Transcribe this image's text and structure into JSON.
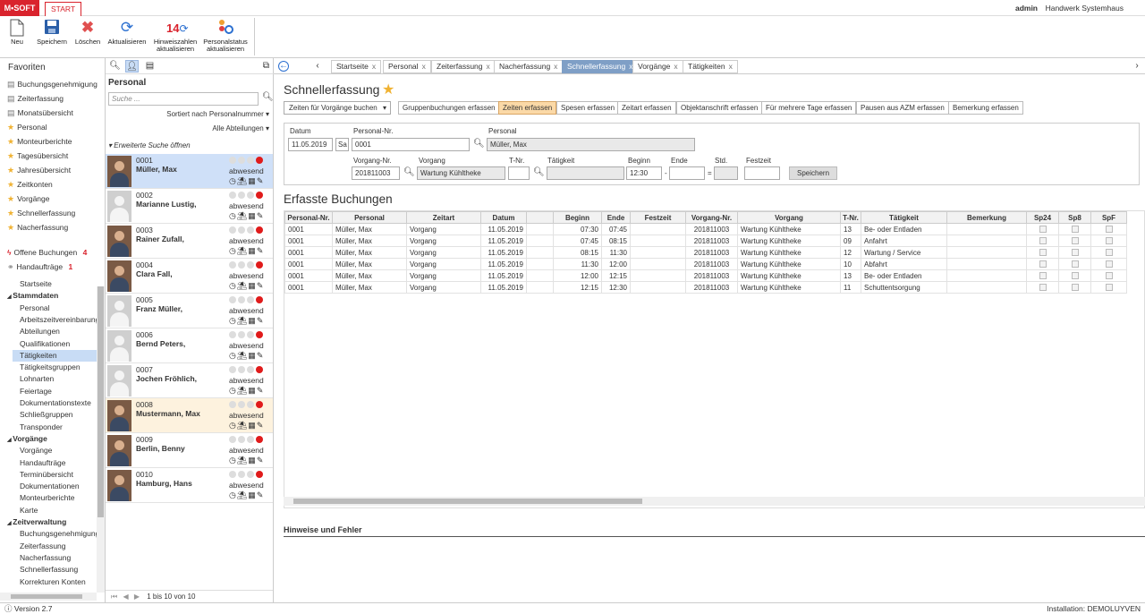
{
  "app": {
    "brand": "M•SOFT",
    "tab": "START",
    "user": "admin",
    "company": "Handwerk Systemhaus"
  },
  "ribbon": [
    {
      "id": "new",
      "label": "Neu",
      "icon": "document-icon"
    },
    {
      "id": "save",
      "label": "Speichern",
      "icon": "save-icon"
    },
    {
      "id": "delete",
      "label": "Löschen",
      "icon": "delete-icon"
    },
    {
      "id": "refresh",
      "label": "Aktualisieren",
      "icon": "refresh-icon"
    },
    {
      "id": "hints",
      "label": "Hinweiszahlen aktualisieren",
      "icon": "hint-refresh-icon",
      "badge": "14"
    },
    {
      "id": "pstatus",
      "label": "Personalstatus aktualisieren",
      "icon": "status-refresh-icon"
    }
  ],
  "favorites": {
    "title": "Favoriten",
    "items": [
      {
        "label": "Buchungsgenehmigung",
        "icon": "doc"
      },
      {
        "label": "Zeiterfassung",
        "icon": "doc"
      },
      {
        "label": "Monatsübersicht",
        "icon": "doc"
      },
      {
        "label": "Personal",
        "icon": "star"
      },
      {
        "label": "Monteurberichte",
        "icon": "star"
      },
      {
        "label": "Tagesübersicht",
        "icon": "star"
      },
      {
        "label": "Jahresübersicht",
        "icon": "star"
      },
      {
        "label": "Zeitkonten",
        "icon": "star"
      },
      {
        "label": "Vorgänge",
        "icon": "star"
      },
      {
        "label": "Schnellerfassung",
        "icon": "star"
      },
      {
        "label": "Nacherfassung",
        "icon": "star"
      }
    ],
    "open_bookings": {
      "label": "Offene Buchungen",
      "count": "4"
    },
    "orders": {
      "label": "Handaufträge",
      "count": "1"
    }
  },
  "tree": [
    {
      "label": "Startseite",
      "level": 1
    },
    {
      "label": "Stammdaten",
      "level": 0,
      "group": true
    },
    {
      "label": "Personal",
      "level": 1
    },
    {
      "label": "Arbeitszeitvereinbarungen",
      "level": 1
    },
    {
      "label": "Abteilungen",
      "level": 1
    },
    {
      "label": "Qualifikationen",
      "level": 1
    },
    {
      "label": "Tätigkeiten",
      "level": 1,
      "selected": true
    },
    {
      "label": "Tätigkeitsgruppen",
      "level": 1
    },
    {
      "label": "Lohnarten",
      "level": 1
    },
    {
      "label": "Feiertage",
      "level": 1
    },
    {
      "label": "Dokumentationstexte",
      "level": 1
    },
    {
      "label": "Schließgruppen",
      "level": 1
    },
    {
      "label": "Transponder",
      "level": 1
    },
    {
      "label": "Vorgänge",
      "level": 0,
      "group": true
    },
    {
      "label": "Vorgänge",
      "level": 1
    },
    {
      "label": "Handaufträge",
      "level": 1
    },
    {
      "label": "Terminübersicht",
      "level": 1
    },
    {
      "label": "Dokumentationen",
      "level": 1
    },
    {
      "label": "Monteurberichte",
      "level": 1
    },
    {
      "label": "Karte",
      "level": 1
    },
    {
      "label": "Zeitverwaltung",
      "level": 0,
      "group": true
    },
    {
      "label": "Buchungsgenehmigung",
      "level": 1
    },
    {
      "label": "Zeiterfassung",
      "level": 1
    },
    {
      "label": "Nacherfassung",
      "level": 1
    },
    {
      "label": "Schnellerfassung",
      "level": 1
    },
    {
      "label": "Korrekturen Konten",
      "level": 1
    }
  ],
  "personal_panel": {
    "title": "Personal",
    "search_placeholder": "Suche ...",
    "sort": "Sortiert nach Personalnummer",
    "dept": "Alle Abteilungen",
    "advanced": "Erweiterte Suche öffnen",
    "footer": "1 bis 10 von 10",
    "people": [
      {
        "num": "0001",
        "name": "Müller, Max",
        "status": "abwesend",
        "photo": true,
        "selected": true
      },
      {
        "num": "0002",
        "name": "Marianne Lustig,",
        "status": "abwesend",
        "photo": false
      },
      {
        "num": "0003",
        "name": "Rainer Zufall,",
        "status": "abwesend",
        "photo": true
      },
      {
        "num": "0004",
        "name": "Clara Fall,",
        "status": "abwesend",
        "photo": true
      },
      {
        "num": "0005",
        "name": "Franz Müller,",
        "status": "abwesend",
        "photo": false
      },
      {
        "num": "0006",
        "name": "Bernd Peters,",
        "status": "abwesend",
        "photo": false
      },
      {
        "num": "0007",
        "name": "Jochen Fröhlich,",
        "status": "abwesend",
        "photo": false
      },
      {
        "num": "0008",
        "name": "Mustermann, Max",
        "status": "abwesend",
        "photo": true,
        "highlight": true
      },
      {
        "num": "0009",
        "name": "Berlin, Benny",
        "status": "abwesend",
        "photo": true
      },
      {
        "num": "0010",
        "name": "Hamburg, Hans",
        "status": "abwesend",
        "photo": true
      }
    ]
  },
  "tabs": [
    {
      "label": "Startseite"
    },
    {
      "label": "Personal"
    },
    {
      "label": "Zeiterfassung"
    },
    {
      "label": "Nacherfassung"
    },
    {
      "label": "Schnellerfassung",
      "active": true
    },
    {
      "label": "Vorgänge"
    },
    {
      "label": "Tätigkeiten"
    }
  ],
  "main": {
    "title": "Schnellerfassung",
    "mode": "Zeiten für Vorgänge buchen",
    "actions": [
      {
        "label": "Gruppenbuchungen erfassen"
      },
      {
        "label": "Zeiten erfassen",
        "active": true
      },
      {
        "label": "Spesen erfassen"
      },
      {
        "label": "Zeitart erfassen"
      },
      {
        "label": "Objektanschrift erfassen"
      },
      {
        "label": "Für mehrere Tage erfassen"
      },
      {
        "label": "Pausen aus AZM erfassen"
      },
      {
        "label": "Bemerkung erfassen"
      }
    ],
    "form": {
      "datum_label": "Datum",
      "datum": "11.05.2019",
      "weekday": "Sa",
      "pnr_label": "Personal-Nr.",
      "pnr": "0001",
      "personal_label": "Personal",
      "personal": "Müller, Max",
      "vnr_label": "Vorgang-Nr.",
      "vnr": "201811003",
      "vorgang_label": "Vorgang",
      "vorgang": "Wartung Kühltheke",
      "tnr_label": "T-Nr.",
      "tnr": "",
      "taetigkeit_label": "Tätigkeit",
      "taetigkeit": "",
      "beginn_label": "Beginn",
      "beginn": "12:30",
      "ende_label": "Ende",
      "ende": "",
      "std_label": "Std.",
      "std": "",
      "festzeit_label": "Festzeit",
      "festzeit": "",
      "save_label": "Speichern"
    },
    "bookings_title": "Erfasste Buchungen",
    "columns": [
      "Personal-Nr.",
      "Personal",
      "Zeitart",
      "Datum",
      "",
      "Beginn",
      "Ende",
      "Festzeit",
      "Vorgang-Nr.",
      "Vorgang",
      "T-Nr.",
      "Tätigkeit",
      "Bemerkung",
      "Sp24",
      "Sp8",
      "SpF"
    ],
    "rows": [
      [
        "0001",
        "Müller, Max",
        "Vorgang",
        "11.05.2019",
        "",
        "07:30",
        "07:45",
        "",
        "201811003",
        "Wartung Kühltheke",
        "13",
        "Be- oder Entladen",
        ""
      ],
      [
        "0001",
        "Müller, Max",
        "Vorgang",
        "11.05.2019",
        "",
        "07:45",
        "08:15",
        "",
        "201811003",
        "Wartung Kühltheke",
        "09",
        "Anfahrt",
        ""
      ],
      [
        "0001",
        "Müller, Max",
        "Vorgang",
        "11.05.2019",
        "",
        "08:15",
        "11:30",
        "",
        "201811003",
        "Wartung Kühltheke",
        "12",
        "Wartung / Service",
        ""
      ],
      [
        "0001",
        "Müller, Max",
        "Vorgang",
        "11.05.2019",
        "",
        "11:30",
        "12:00",
        "",
        "201811003",
        "Wartung Kühltheke",
        "10",
        "Abfahrt",
        ""
      ],
      [
        "0001",
        "Müller, Max",
        "Vorgang",
        "11.05.2019",
        "",
        "12:00",
        "12:15",
        "",
        "201811003",
        "Wartung Kühltheke",
        "13",
        "Be- oder Entladen",
        ""
      ],
      [
        "0001",
        "Müller, Max",
        "Vorgang",
        "11.05.2019",
        "",
        "12:15",
        "12:30",
        "",
        "201811003",
        "Wartung Kühltheke",
        "11",
        "Schuttentsorgung",
        ""
      ]
    ],
    "notes_title": "Hinweise und Fehler"
  },
  "status": {
    "version": "Version 2.7",
    "install": "Installation: DEMOLUYVEN"
  }
}
